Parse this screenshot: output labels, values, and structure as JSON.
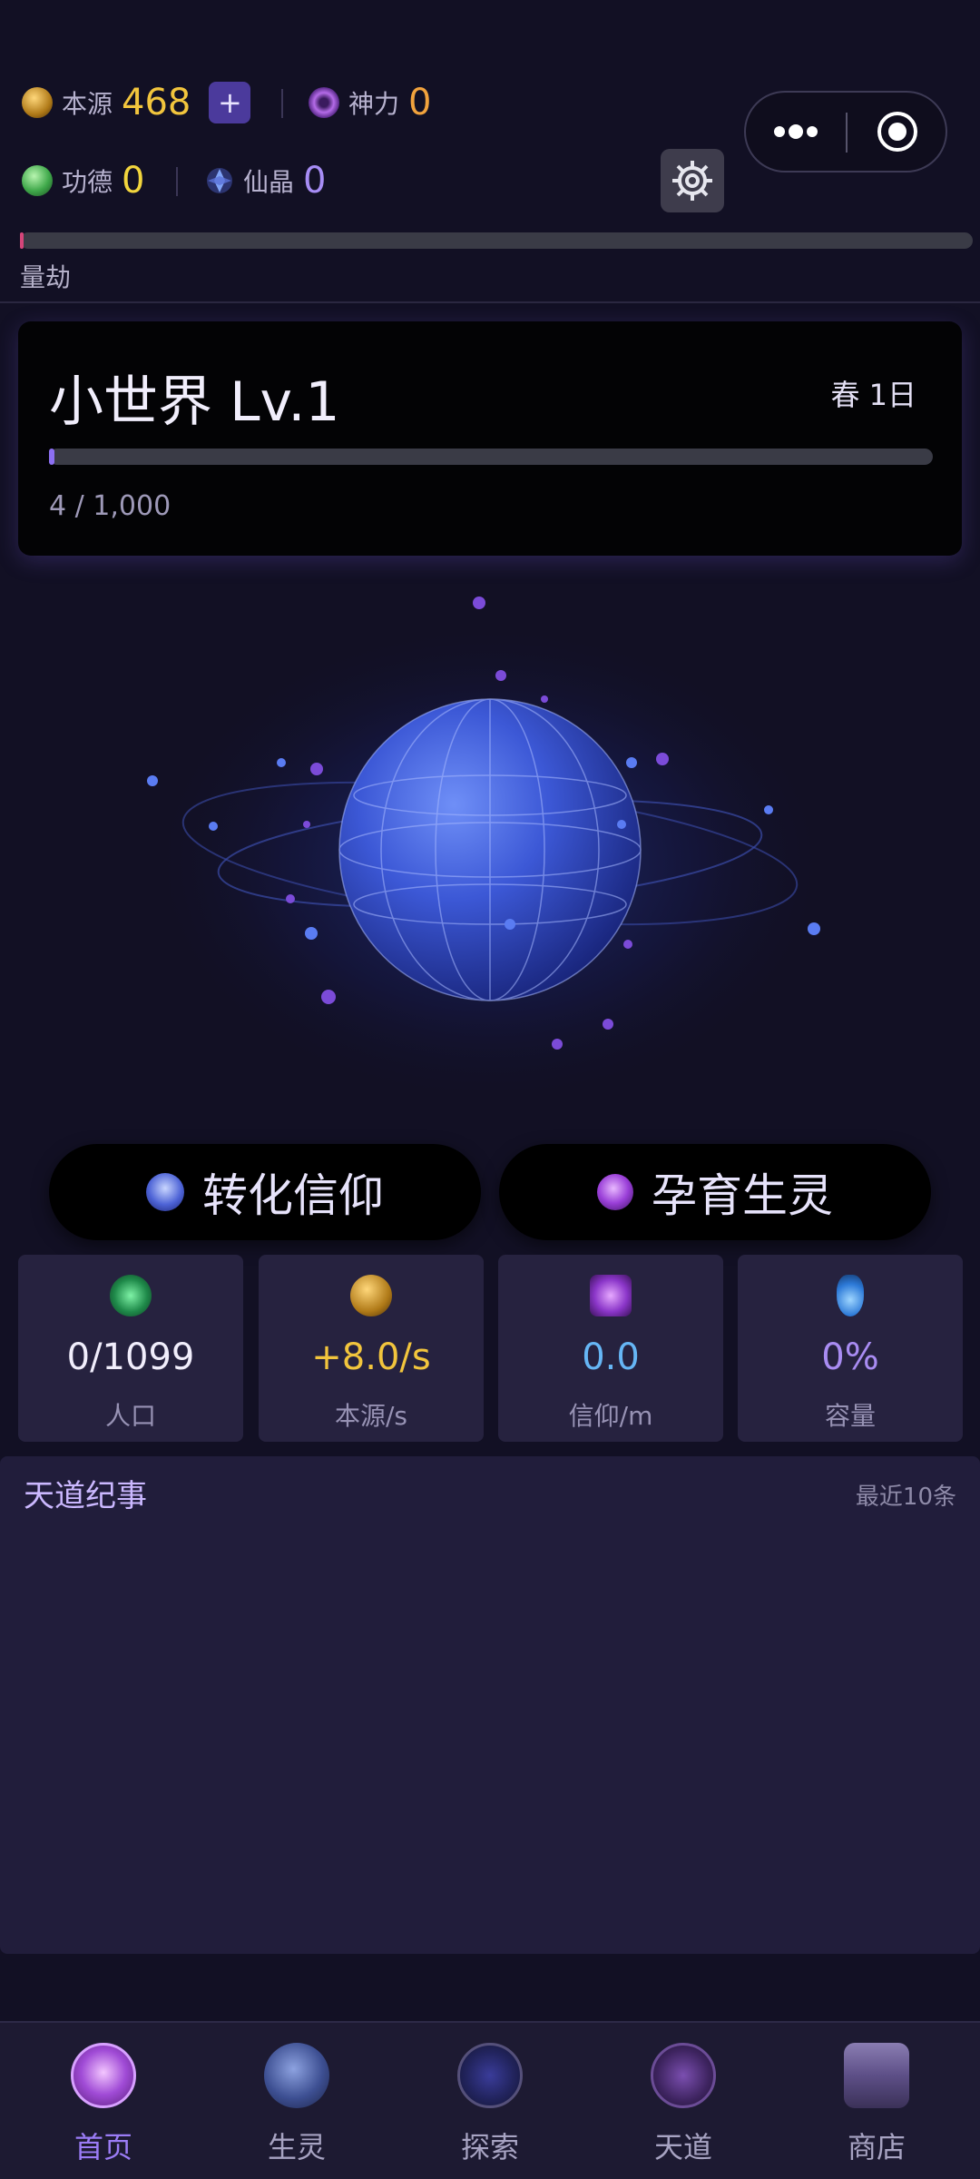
{
  "resources": {
    "benyuan": {
      "label": "本源",
      "value": "468",
      "add": "+"
    },
    "shenli": {
      "label": "神力",
      "value": "0"
    },
    "gongde": {
      "label": "功德",
      "value": "0"
    },
    "xianjing": {
      "label": "仙晶",
      "value": "0"
    }
  },
  "calamity": {
    "label": "量劫",
    "progress": 0.003
  },
  "world": {
    "title": "小世界 Lv.1",
    "season": "春 1日",
    "exp_text": "4 / 1,000",
    "exp_progress": 0.004
  },
  "actions": {
    "convert": "转化信仰",
    "breed": "孕育生灵"
  },
  "stats": [
    {
      "value": "0/1099",
      "label": "人口",
      "color": "#f1eefc",
      "icon": "population-icon"
    },
    {
      "value": "+8.0/s",
      "label": "本源/s",
      "color": "#f2c53d",
      "icon": "origin-rate-icon"
    },
    {
      "value": "0.0",
      "label": "信仰/m",
      "color": "#66b6f5",
      "icon": "faith-rate-icon"
    },
    {
      "value": "0%",
      "label": "容量",
      "color": "#a98cf2",
      "icon": "capacity-icon"
    }
  ],
  "annals": {
    "title": "天道纪事",
    "meta": "最近10条"
  },
  "nav": [
    {
      "label": "首页",
      "icon": "home-temple-icon",
      "active": true
    },
    {
      "label": "生灵",
      "icon": "dragon-icon",
      "active": false
    },
    {
      "label": "探索",
      "icon": "compass-icon",
      "active": false
    },
    {
      "label": "天道",
      "icon": "yin-yang-icon",
      "active": false
    },
    {
      "label": "商店",
      "icon": "treasure-chest-icon",
      "active": false
    }
  ],
  "colors": {
    "gold": "#f2c53d",
    "accent_purple": "#8b6cf0",
    "background": "#121024"
  }
}
